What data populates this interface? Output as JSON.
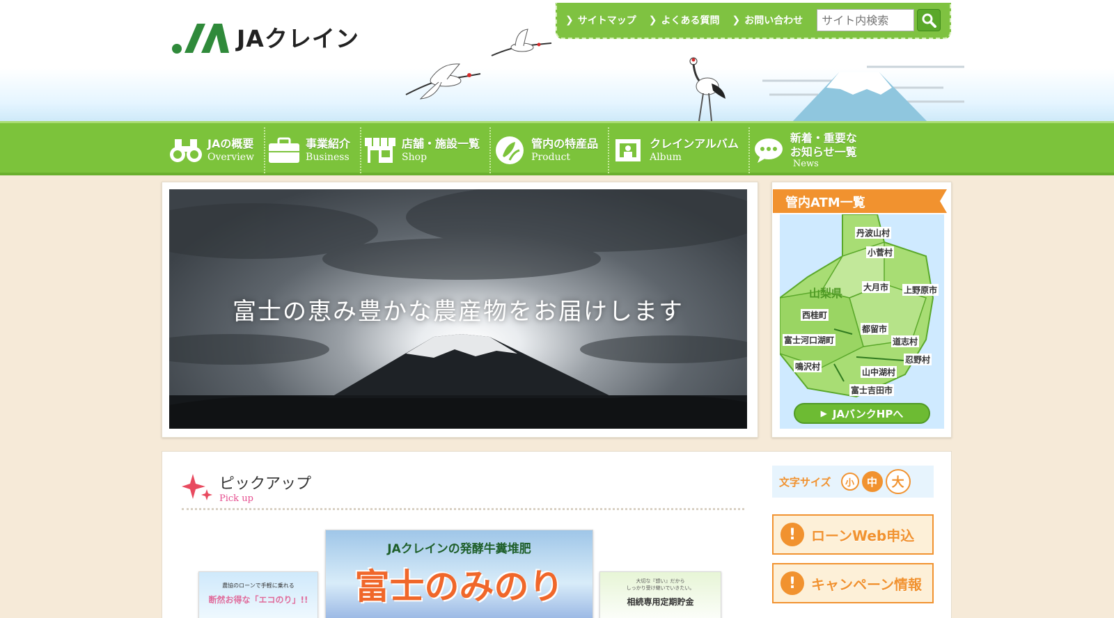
{
  "brand": {
    "name": "JAクレイン"
  },
  "util_nav": {
    "links": [
      {
        "label": "サイトマップ"
      },
      {
        "label": "よくある質問"
      },
      {
        "label": "お問い合わせ"
      }
    ],
    "search": {
      "placeholder": "サイト内検索"
    }
  },
  "main_nav": [
    {
      "jp": "JAの概要",
      "en": "Overview",
      "icon": "binoculars-icon"
    },
    {
      "jp": "事業紹介",
      "en": "Business",
      "icon": "briefcase-icon"
    },
    {
      "jp": "店舗・施設一覧",
      "en": "Shop",
      "icon": "shop-icon"
    },
    {
      "jp": "管内の特産品",
      "en": "Product",
      "icon": "product-icon"
    },
    {
      "jp": "クレインアルバム",
      "en": "Album",
      "icon": "album-icon"
    },
    {
      "jp": "新着・重要な",
      "jp2": "お知らせ一覧",
      "en": "News",
      "icon": "speech-bubble-icon"
    }
  ],
  "hero": {
    "caption": "富士の恵み豊かな農産物をお届けします"
  },
  "atm": {
    "title": "管内ATM一覧",
    "prefecture": "山梨県",
    "locations": [
      "丹波山村",
      "小菅村",
      "大月市",
      "上野原市",
      "西桂町",
      "都留市",
      "富士河口湖町",
      "道志村",
      "忍野村",
      "鳴沢村",
      "山中湖村",
      "富士吉田市"
    ],
    "bank_button": "JAバンクHPへ"
  },
  "pickup": {
    "title": "ピックアップ",
    "subtitle": "Pick up",
    "banners": {
      "left": {
        "line1": "農協のローンで手軽に乗れる",
        "line2": "断然お得な「エコのり」!!"
      },
      "center": {
        "brand": "JAクレインの発酵牛糞堆肥",
        "title": "富士のみのり"
      },
      "right": {
        "line1": "大切な『想い』だから",
        "line2": "しっかり受け継いでいきたい。",
        "line3": "相続専用定期貯金"
      }
    }
  },
  "font_size": {
    "label": "文字サイズ",
    "options": [
      "小",
      "中",
      "大"
    ],
    "active": "中"
  },
  "side_buttons": [
    {
      "label": "ローンWeb申込"
    },
    {
      "label": "キャンペーン情報"
    }
  ],
  "colors": {
    "nav_green": "#7cc33b",
    "accent_orange": "#f1922f",
    "background": "#f6ead8"
  }
}
